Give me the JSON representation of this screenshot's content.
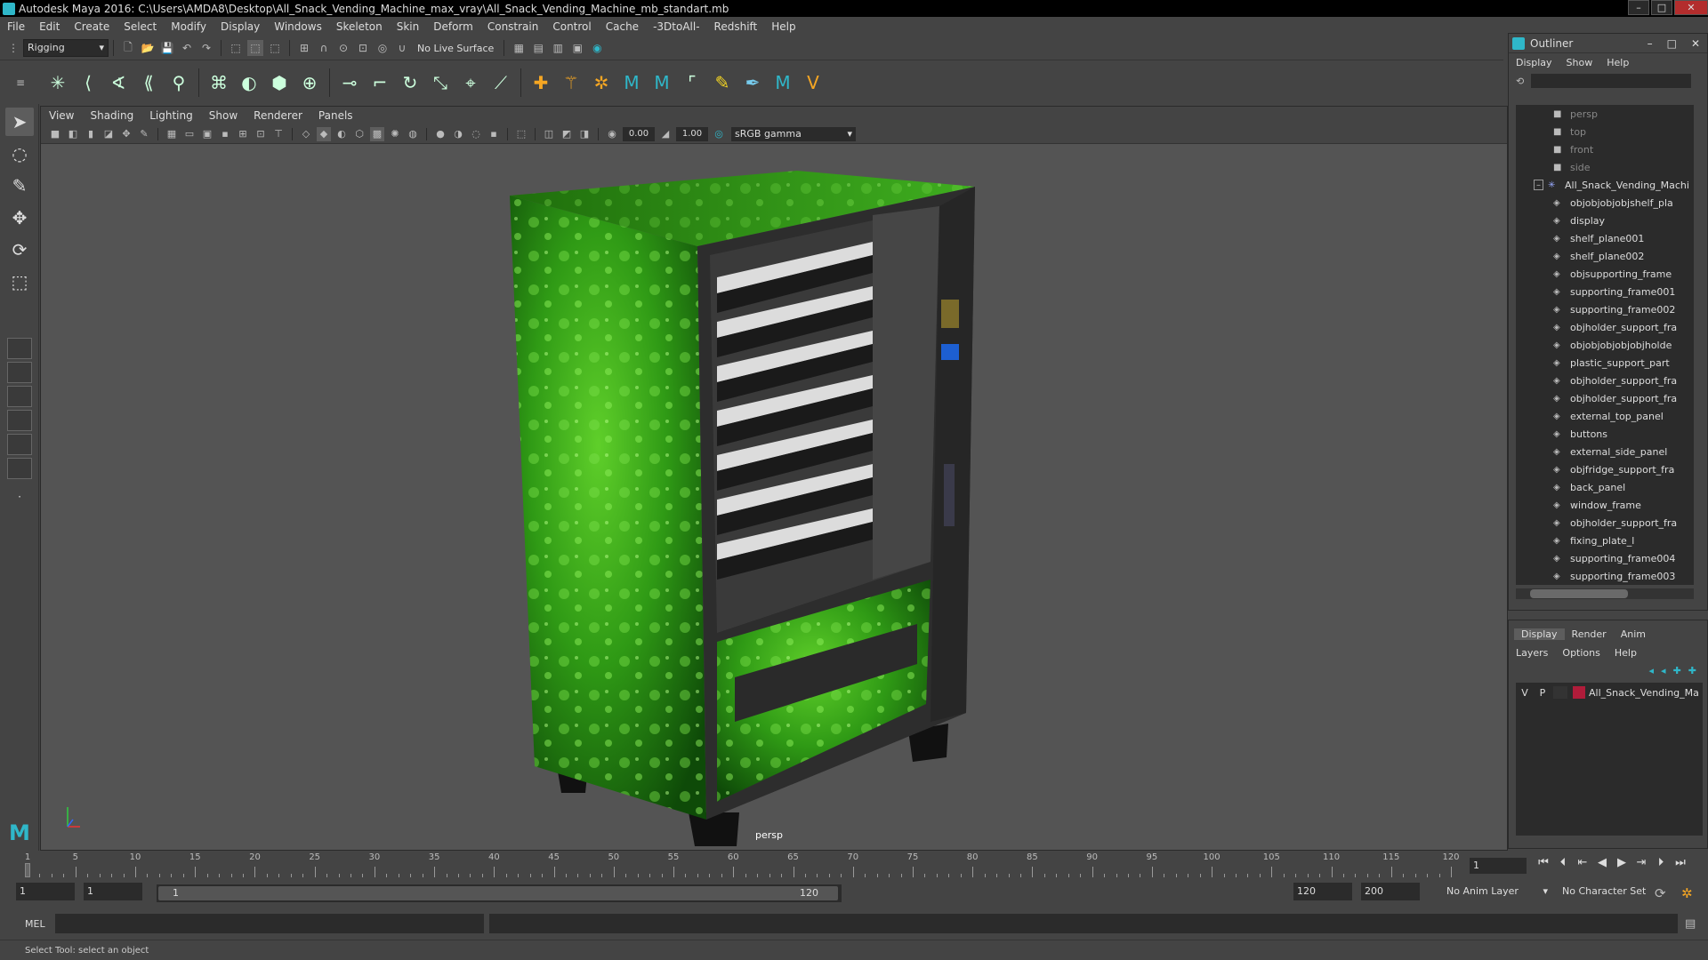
{
  "window": {
    "title": "Autodesk Maya 2016: C:\\Users\\AMDA8\\Desktop\\All_Snack_Vending_Machine_max_vray\\All_Snack_Vending_Machine_mb_standart.mb",
    "minimize": "–",
    "maximize": "□",
    "close": "✕"
  },
  "menubar": [
    "File",
    "Edit",
    "Create",
    "Select",
    "Modify",
    "Display",
    "Windows",
    "Skeleton",
    "Skin",
    "Deform",
    "Constrain",
    "Control",
    "Cache",
    "-3DtoAll-",
    "Redshift",
    "Help"
  ],
  "statusline": {
    "menuset": "Rigging",
    "live_surface": "No Live Surface"
  },
  "viewport": {
    "menu": [
      "View",
      "Shading",
      "Lighting",
      "Show",
      "Renderer",
      "Panels"
    ],
    "exposure": "0.00",
    "gamma": "1.00",
    "color_space": "sRGB gamma",
    "camera_label": "persp"
  },
  "outliner": {
    "title": "Outliner",
    "menu": [
      "Display",
      "Show",
      "Help"
    ],
    "items": [
      {
        "label": "persp",
        "kind": "camera"
      },
      {
        "label": "top",
        "kind": "camera"
      },
      {
        "label": "front",
        "kind": "camera"
      },
      {
        "label": "side",
        "kind": "camera"
      },
      {
        "label": "All_Snack_Vending_Machi",
        "kind": "root"
      },
      {
        "label": "objobjobjobjshelf_pla",
        "kind": "mesh"
      },
      {
        "label": "display",
        "kind": "mesh"
      },
      {
        "label": "shelf_plane001",
        "kind": "mesh"
      },
      {
        "label": "shelf_plane002",
        "kind": "mesh"
      },
      {
        "label": "objsupporting_frame",
        "kind": "mesh"
      },
      {
        "label": "supporting_frame001",
        "kind": "mesh"
      },
      {
        "label": "supporting_frame002",
        "kind": "mesh"
      },
      {
        "label": "objholder_support_fra",
        "kind": "mesh"
      },
      {
        "label": "objobjobjobjobjholde",
        "kind": "mesh"
      },
      {
        "label": "plastic_support_part",
        "kind": "mesh"
      },
      {
        "label": "objholder_support_fra",
        "kind": "mesh"
      },
      {
        "label": "objholder_support_fra",
        "kind": "mesh"
      },
      {
        "label": "external_top_panel",
        "kind": "mesh"
      },
      {
        "label": "buttons",
        "kind": "mesh"
      },
      {
        "label": "external_side_panel",
        "kind": "mesh"
      },
      {
        "label": "objfridge_support_fra",
        "kind": "mesh"
      },
      {
        "label": "back_panel",
        "kind": "mesh"
      },
      {
        "label": "window_frame",
        "kind": "mesh"
      },
      {
        "label": "objholder_support_fra",
        "kind": "mesh"
      },
      {
        "label": "fixing_plate_l",
        "kind": "mesh"
      },
      {
        "label": "supporting_frame004",
        "kind": "mesh"
      },
      {
        "label": "supporting_frame003",
        "kind": "mesh"
      }
    ]
  },
  "layer_editor": {
    "tabs": [
      "Display",
      "Render",
      "Anim"
    ],
    "menu": [
      "Layers",
      "Options",
      "Help"
    ],
    "layer": {
      "v": "V",
      "p": "P",
      "name": "All_Snack_Vending_Ma",
      "color": "#b01c3a"
    }
  },
  "timeline": {
    "ticks": [
      1,
      5,
      10,
      15,
      20,
      25,
      30,
      35,
      40,
      45,
      50,
      55,
      60,
      65,
      70,
      75,
      80,
      85,
      90,
      95,
      100,
      105,
      110,
      115,
      120
    ],
    "current_frame": "1"
  },
  "range": {
    "start": "1",
    "playback_start": "1",
    "slider_start": "1",
    "slider_end": "120",
    "playback_end": "120",
    "end": "200",
    "anim_layer": "No Anim Layer",
    "character_set": "No Character Set"
  },
  "commandline": {
    "language": "MEL",
    "help": "Select Tool: select an object"
  },
  "colors": {
    "accent": "#2fb7c9",
    "vending_green": "#3aa020"
  }
}
